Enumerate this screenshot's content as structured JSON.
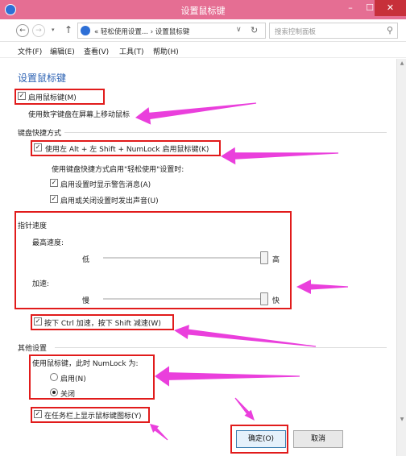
{
  "window": {
    "title": "设置鼠标键",
    "min_glyph": "–",
    "max_glyph": "☐",
    "close_glyph": "✕"
  },
  "address": {
    "back_glyph": "←",
    "forward_glyph": "→",
    "dropdown_glyph": "▾",
    "up_glyph": "↑",
    "breadcrumb": "« 轻松使用设置... › 设置鼠标键",
    "crumb_dropdown_glyph": "∨",
    "refresh_glyph": "↻",
    "search_placeholder": "搜索控制面板",
    "search_glyph": "⚲"
  },
  "menu": {
    "file": "文件(F)",
    "edit": "编辑(E)",
    "view": "查看(V)",
    "tools": "工具(T)",
    "help": "帮助(H)"
  },
  "page": {
    "heading": "设置鼠标键",
    "enable_mouse_keys": "启用鼠标键(M)",
    "enable_mouse_keys_desc": "使用数字键盘在屏幕上移动鼠标",
    "shortcut_section": "键盘快捷方式",
    "shortcut_toggle": "使用左 Alt + 左 Shift + NumLock 启用鼠标键(K)",
    "shortcut_note": "使用键盘快捷方式启用\"轻松使用\"设置时:",
    "show_warning": "启用设置时显示警告消息(A)",
    "play_sound": "启用或关闭设置时发出声音(U)",
    "pointer_section": "指针速度",
    "top_speed_label": "最高速度:",
    "low": "低",
    "high": "高",
    "accel_label": "加速:",
    "slow": "慢",
    "fast": "快",
    "ctrl_shift": "按下 Ctrl 加速，按下 Shift 减速(W)",
    "other_section": "其他设置",
    "numlock_question": "使用鼠标键，此时 NumLock 为:",
    "on": "启用(N)",
    "off": "关闭",
    "taskbar_icon": "在任务栏上显示鼠标键图标(Y)",
    "check_glyph": "✓"
  },
  "controls": {
    "top_speed_level": 1.0,
    "acceleration_level": 1.0,
    "numlock_selected": "off",
    "enable_mouse_keys": true,
    "shortcut_toggle": true,
    "show_warning": true,
    "play_sound": true,
    "ctrl_shift": true,
    "taskbar_icon": true
  },
  "buttons": {
    "ok": "确定(O)",
    "cancel": "取消"
  },
  "colors": {
    "titlebar": "#e56e93",
    "highlight_box": "#e11b1b",
    "arrow": "#ea3fdc",
    "heading": "#2c62b3"
  }
}
